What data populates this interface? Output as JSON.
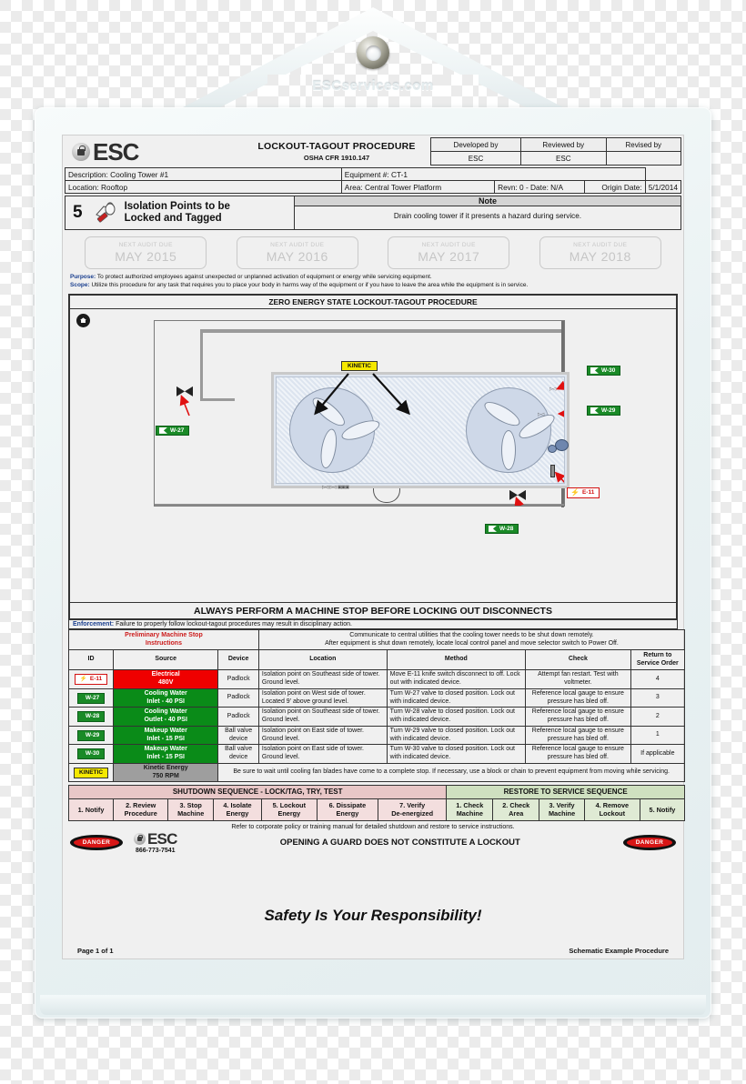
{
  "holder": {
    "brand": "ESCservices.com"
  },
  "header": {
    "logo_text": "ESC",
    "title": "LOCKOUT-TAGOUT PROCEDURE",
    "subtitle": "OSHA CFR 1910.147",
    "signoff": {
      "columns": [
        "Developed by",
        "Reviewed by",
        "Revised by"
      ],
      "values": [
        "ESC",
        "ESC",
        ""
      ]
    },
    "description_label": "Description:",
    "description": "Cooling Tower #1",
    "equipment_label": "Equipment #:",
    "equipment": "CT-1",
    "location_label": "Location:",
    "location": "Rooftop",
    "area_label": "Area:",
    "area": "Central Tower Platform",
    "revision": "Revn: 0   -   Date: N/A",
    "origin_label": "Origin Date:",
    "origin_date": "5/1/2014"
  },
  "isolation": {
    "count": "5",
    "label_line1": "Isolation Points to be",
    "label_line2": "Locked and Tagged",
    "note_header": "Note",
    "note_text": "Drain cooling tower if it presents a hazard during service."
  },
  "audits": [
    {
      "caption": "NEXT AUDIT DUE",
      "date": "MAY 2015"
    },
    {
      "caption": "NEXT AUDIT DUE",
      "date": "MAY 2016"
    },
    {
      "caption": "NEXT AUDIT DUE",
      "date": "MAY 2017"
    },
    {
      "caption": "NEXT AUDIT DUE",
      "date": "MAY 2018"
    }
  ],
  "purpose": {
    "purpose_label": "Purpose:",
    "purpose_text": "To protect authorized employees against unexpected or unplanned activation of equipment or energy while servicing equipment.",
    "scope_label": "Scope:",
    "scope_text": "Utilize this procedure for any task that requires you to place your body in harms way of the equipment or if you have to leave the area while the equipment is in service."
  },
  "schematic": {
    "title": "ZERO ENERGY STATE LOCKOUT-TAGOUT PROCEDURE",
    "kinetic_tag": "KINETIC",
    "tags": [
      {
        "id": "W-27",
        "type": "valve"
      },
      {
        "id": "W-28",
        "type": "valve"
      },
      {
        "id": "W-29",
        "type": "valve"
      },
      {
        "id": "W-30",
        "type": "valve"
      },
      {
        "id": "E-11",
        "type": "electrical"
      }
    ],
    "footer_warning": "ALWAYS PERFORM A MACHINE STOP BEFORE LOCKING OUT DISCONNECTS"
  },
  "enforcement": {
    "label": "Enforcement:",
    "text": "Failure to properly follow lockout-tagout procedures may result in disciplinary action."
  },
  "preliminary": {
    "label_line1": "Preliminary Machine Stop",
    "label_line2": "Instructions",
    "text_line1": "Communicate to central utilities that the cooling tower needs to be shut down remotely.",
    "text_line2": "After equipment is shut down remotely, locate local control panel and move selector switch to Power Off."
  },
  "procedure_table": {
    "columns": [
      "ID",
      "Source",
      "Device",
      "Location",
      "Method",
      "Check",
      "Return to Service Order"
    ],
    "rows": [
      {
        "id": "E-11",
        "id_type": "electrical",
        "source_line1": "Electrical",
        "source_line2": "480V",
        "source_color": "#ef0000",
        "device": "Padlock",
        "location": "Isolation point on Southeast side of tower.  Ground level.",
        "method": "Move E-11 knife switch disconnect to off. Lock out with indicated device.",
        "check": "Attempt fan restart. Test with voltmeter.",
        "return_order": "4"
      },
      {
        "id": "W-27",
        "id_type": "valve",
        "source_line1": "Cooling Water",
        "source_line2": "Inlet - 40 PSI",
        "source_color": "#0a8b18",
        "device": "Padlock",
        "location": "Isolation point on West side of tower. Located 9' above ground level.",
        "method": "Turn W-27 valve to closed position. Lock out with indicated device.",
        "check": "Reference local gauge to ensure pressure has bled off.",
        "return_order": "3"
      },
      {
        "id": "W-28",
        "id_type": "valve",
        "source_line1": "Cooling Water",
        "source_line2": "Outlet - 40 PSI",
        "source_color": "#0a8b18",
        "device": "Padlock",
        "location": "Isolation point on Southeast side of tower.  Ground level.",
        "method": "Turn W-28 valve to closed position. Lock out with indicated device.",
        "check": "Reference local gauge to ensure pressure has bled off.",
        "return_order": "2"
      },
      {
        "id": "W-29",
        "id_type": "valve",
        "source_line1": "Makeup Water",
        "source_line2": "Inlet - 15 PSI",
        "source_color": "#0a8b18",
        "device": "Ball valve device",
        "location": "Isolation point on East side of tower. Ground level.",
        "method": "Turn W-29 valve to closed position. Lock out with indicated device.",
        "check": "Reference local gauge to ensure pressure has bled off.",
        "return_order": "1"
      },
      {
        "id": "W-30",
        "id_type": "valve",
        "source_line1": "Makeup Water",
        "source_line2": "Inlet - 15 PSI",
        "source_color": "#0a8b18",
        "device": "Ball valve device",
        "location": "Isolation point on East side of tower. Ground level.",
        "method": "Turn W-30 valve to closed position. Lock out with indicated device.",
        "check": "Reference local gauge to ensure pressure has bled off.",
        "return_order": "If applicable"
      }
    ],
    "kinetic_row": {
      "id": "KINETIC",
      "id_type": "kinetic",
      "source_line1": "Kinetic Energy",
      "source_line2": "750 RPM",
      "source_color": "#9e9e9e",
      "note": "Be sure to wait until cooling fan blades have come to a complete stop.  If necessary, use a block or chain to prevent equipment from moving while servicing."
    }
  },
  "sequences": {
    "shutdown_header": "SHUTDOWN SEQUENCE - LOCK/TAG, TRY, TEST",
    "restore_header": "RESTORE TO SERVICE SEQUENCE",
    "shutdown_steps": [
      {
        "l1": "1. Notify",
        "l2": ""
      },
      {
        "l1": "2. Review",
        "l2": "Procedure"
      },
      {
        "l1": "3. Stop",
        "l2": "Machine"
      },
      {
        "l1": "4. Isolate",
        "l2": "Energy"
      },
      {
        "l1": "5. Lockout",
        "l2": "Energy"
      },
      {
        "l1": "6. Dissipate",
        "l2": "Energy"
      },
      {
        "l1": "7. Verify",
        "l2": "De-energized"
      }
    ],
    "restore_steps": [
      {
        "l1": "1. Check",
        "l2": "Machine"
      },
      {
        "l1": "2. Check",
        "l2": "Area"
      },
      {
        "l1": "3. Verify",
        "l2": "Machine"
      },
      {
        "l1": "4. Remove",
        "l2": "Lockout"
      },
      {
        "l1": "5. Notify",
        "l2": ""
      }
    ]
  },
  "footer": {
    "refer_text": "Refer to corporate policy or training manual for detailed shutdown and restore to service instructions.",
    "danger_left": "DANGER",
    "danger_right": "DANGER",
    "esc_logo": "ESC",
    "phone": "866-773-7541",
    "guard_text": "OPENING A GUARD DOES NOT CONSTITUTE A LOCKOUT",
    "safety_slogan": "Safety Is Your Responsibility!",
    "page": "Page 1 of 1",
    "doc_type": "Schematic Example Procedure"
  },
  "colors": {
    "electrical_red": "#ef0000",
    "water_green": "#0a8b18",
    "kinetic_yellow": "#f5e800",
    "kinetic_gray": "#9e9e9e",
    "danger_red": "#d81616",
    "shutdown_pink": "#f3dede",
    "restore_green": "#dfead4",
    "accent_blue": "#1a3f8f"
  }
}
